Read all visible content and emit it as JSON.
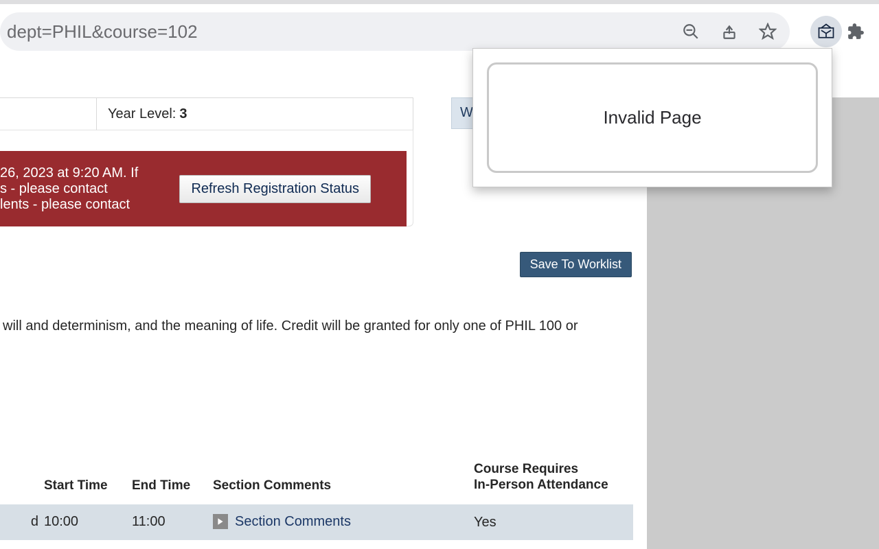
{
  "browser": {
    "url_fragment": "dept=PHIL&course=102"
  },
  "info": {
    "year_label": "Year Level: ",
    "year_value": "3",
    "nav_tab": "W"
  },
  "alert": {
    "line1": "26, 2023 at 9:20 AM. If",
    "line2": "s - please contact",
    "line3": "lents - please contact",
    "refresh_label": "Refresh Registration Status"
  },
  "actions": {
    "save_worklist": "Save To Worklist"
  },
  "description": " will and determinism, and the meaning of life. Credit will be granted for only one of PHIL 100 or",
  "table": {
    "headers": {
      "start": "Start Time",
      "end": "End Time",
      "comments": "Section Comments",
      "inperson_l1": "Course Requires",
      "inperson_l2": "In-Person Attendance"
    },
    "row": {
      "lead": "d",
      "start": "10:00",
      "end": "11:00",
      "comments_link": "Section Comments",
      "inperson": "Yes"
    }
  },
  "popup": {
    "message": "Invalid Page"
  }
}
